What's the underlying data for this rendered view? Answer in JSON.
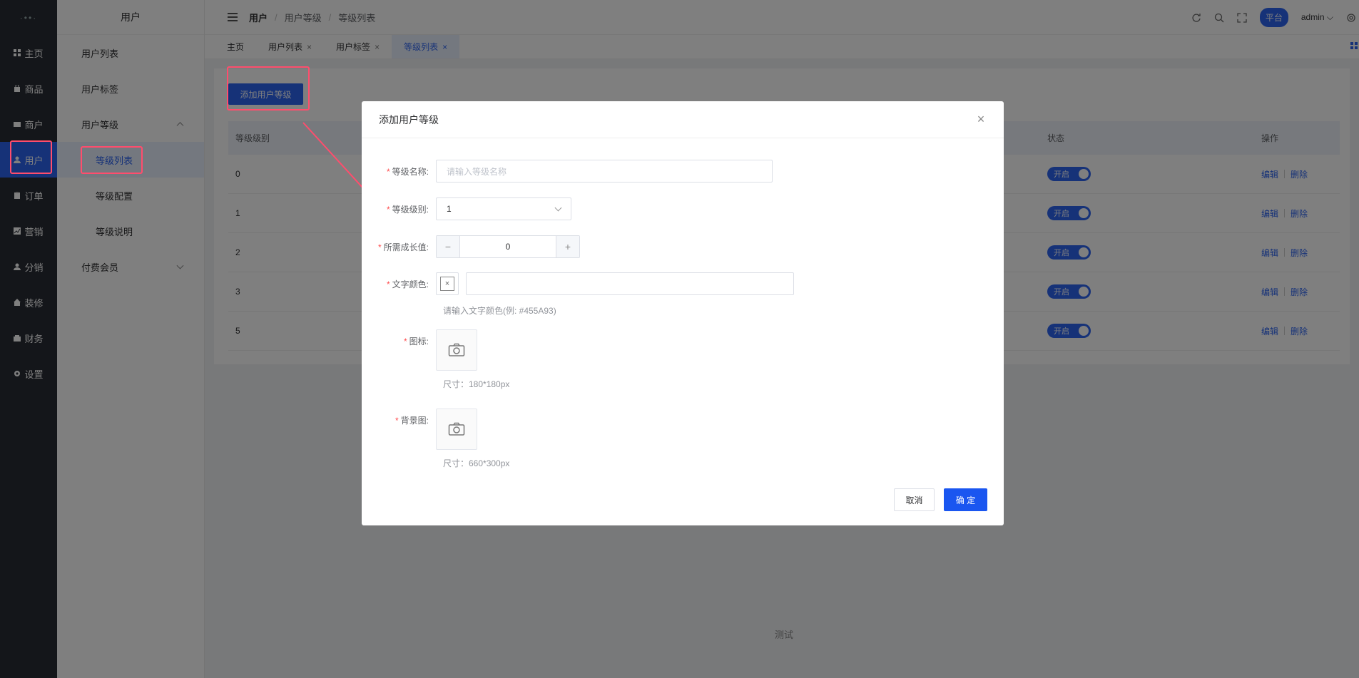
{
  "rail": {
    "logo": "·••·",
    "items": [
      {
        "label": "主页",
        "icon": "dashboard-icon"
      },
      {
        "label": "商品",
        "icon": "bag-icon"
      },
      {
        "label": "商户",
        "icon": "store-icon"
      },
      {
        "label": "用户",
        "icon": "user-icon",
        "active": true
      },
      {
        "label": "订单",
        "icon": "clipboard-icon"
      },
      {
        "label": "营销",
        "icon": "chart-icon"
      },
      {
        "label": "分销",
        "icon": "person-icon"
      },
      {
        "label": "装修",
        "icon": "home-icon"
      },
      {
        "label": "财务",
        "icon": "wallet-icon"
      },
      {
        "label": "设置",
        "icon": "gear-icon"
      }
    ]
  },
  "submenu": {
    "title": "用户",
    "items": [
      {
        "label": "用户列表"
      },
      {
        "label": "用户标签"
      },
      {
        "label": "用户等级"
      },
      {
        "label": "等级列表"
      },
      {
        "label": "等级配置"
      },
      {
        "label": "等级说明"
      },
      {
        "label": "付费会员"
      }
    ]
  },
  "header": {
    "breadcrumb": [
      "用户",
      "用户等级",
      "等级列表"
    ],
    "platform": "平台",
    "user": "admin"
  },
  "tabs": [
    {
      "label": "主页"
    },
    {
      "label": "用户列表",
      "close": "×"
    },
    {
      "label": "用户标签",
      "close": "×"
    },
    {
      "label": "等级列表",
      "close": "×"
    }
  ],
  "content": {
    "add_button": "添加用户等级",
    "columns": {
      "level": "等级级别",
      "status": "状态",
      "actions": "操作"
    },
    "rows": [
      {
        "level": "0",
        "status": "开启"
      },
      {
        "level": "1",
        "status": "开启"
      },
      {
        "level": "2",
        "status": "开启"
      },
      {
        "level": "3",
        "status": "开启"
      },
      {
        "level": "5",
        "status": "开启"
      }
    ],
    "edit": "编辑",
    "delete": "删除",
    "footer": "测试"
  },
  "dialog": {
    "title": "添加用户等级",
    "close": "×",
    "required_mark": "*",
    "name_label": "等级名称:",
    "name_placeholder": "请输入等级名称",
    "level_label": "等级级别:",
    "level_value": "1",
    "growth_label": "所需成长值:",
    "growth_value": "0",
    "minus": "−",
    "plus": "+",
    "color_label": "文字颜色:",
    "color_clear": "×",
    "color_value": "",
    "color_hint": "请输入文字颜色(例: #455A93)",
    "icon_label": "图标:",
    "icon_hint": "尺寸：180*180px",
    "bg_label": "背景图:",
    "bg_hint": "尺寸：660*300px",
    "cancel": "取消",
    "confirm": "确 定"
  },
  "colors": {
    "accent": "#2d64f0",
    "rail": "#282c34",
    "highlight": "#ff4d6d"
  }
}
